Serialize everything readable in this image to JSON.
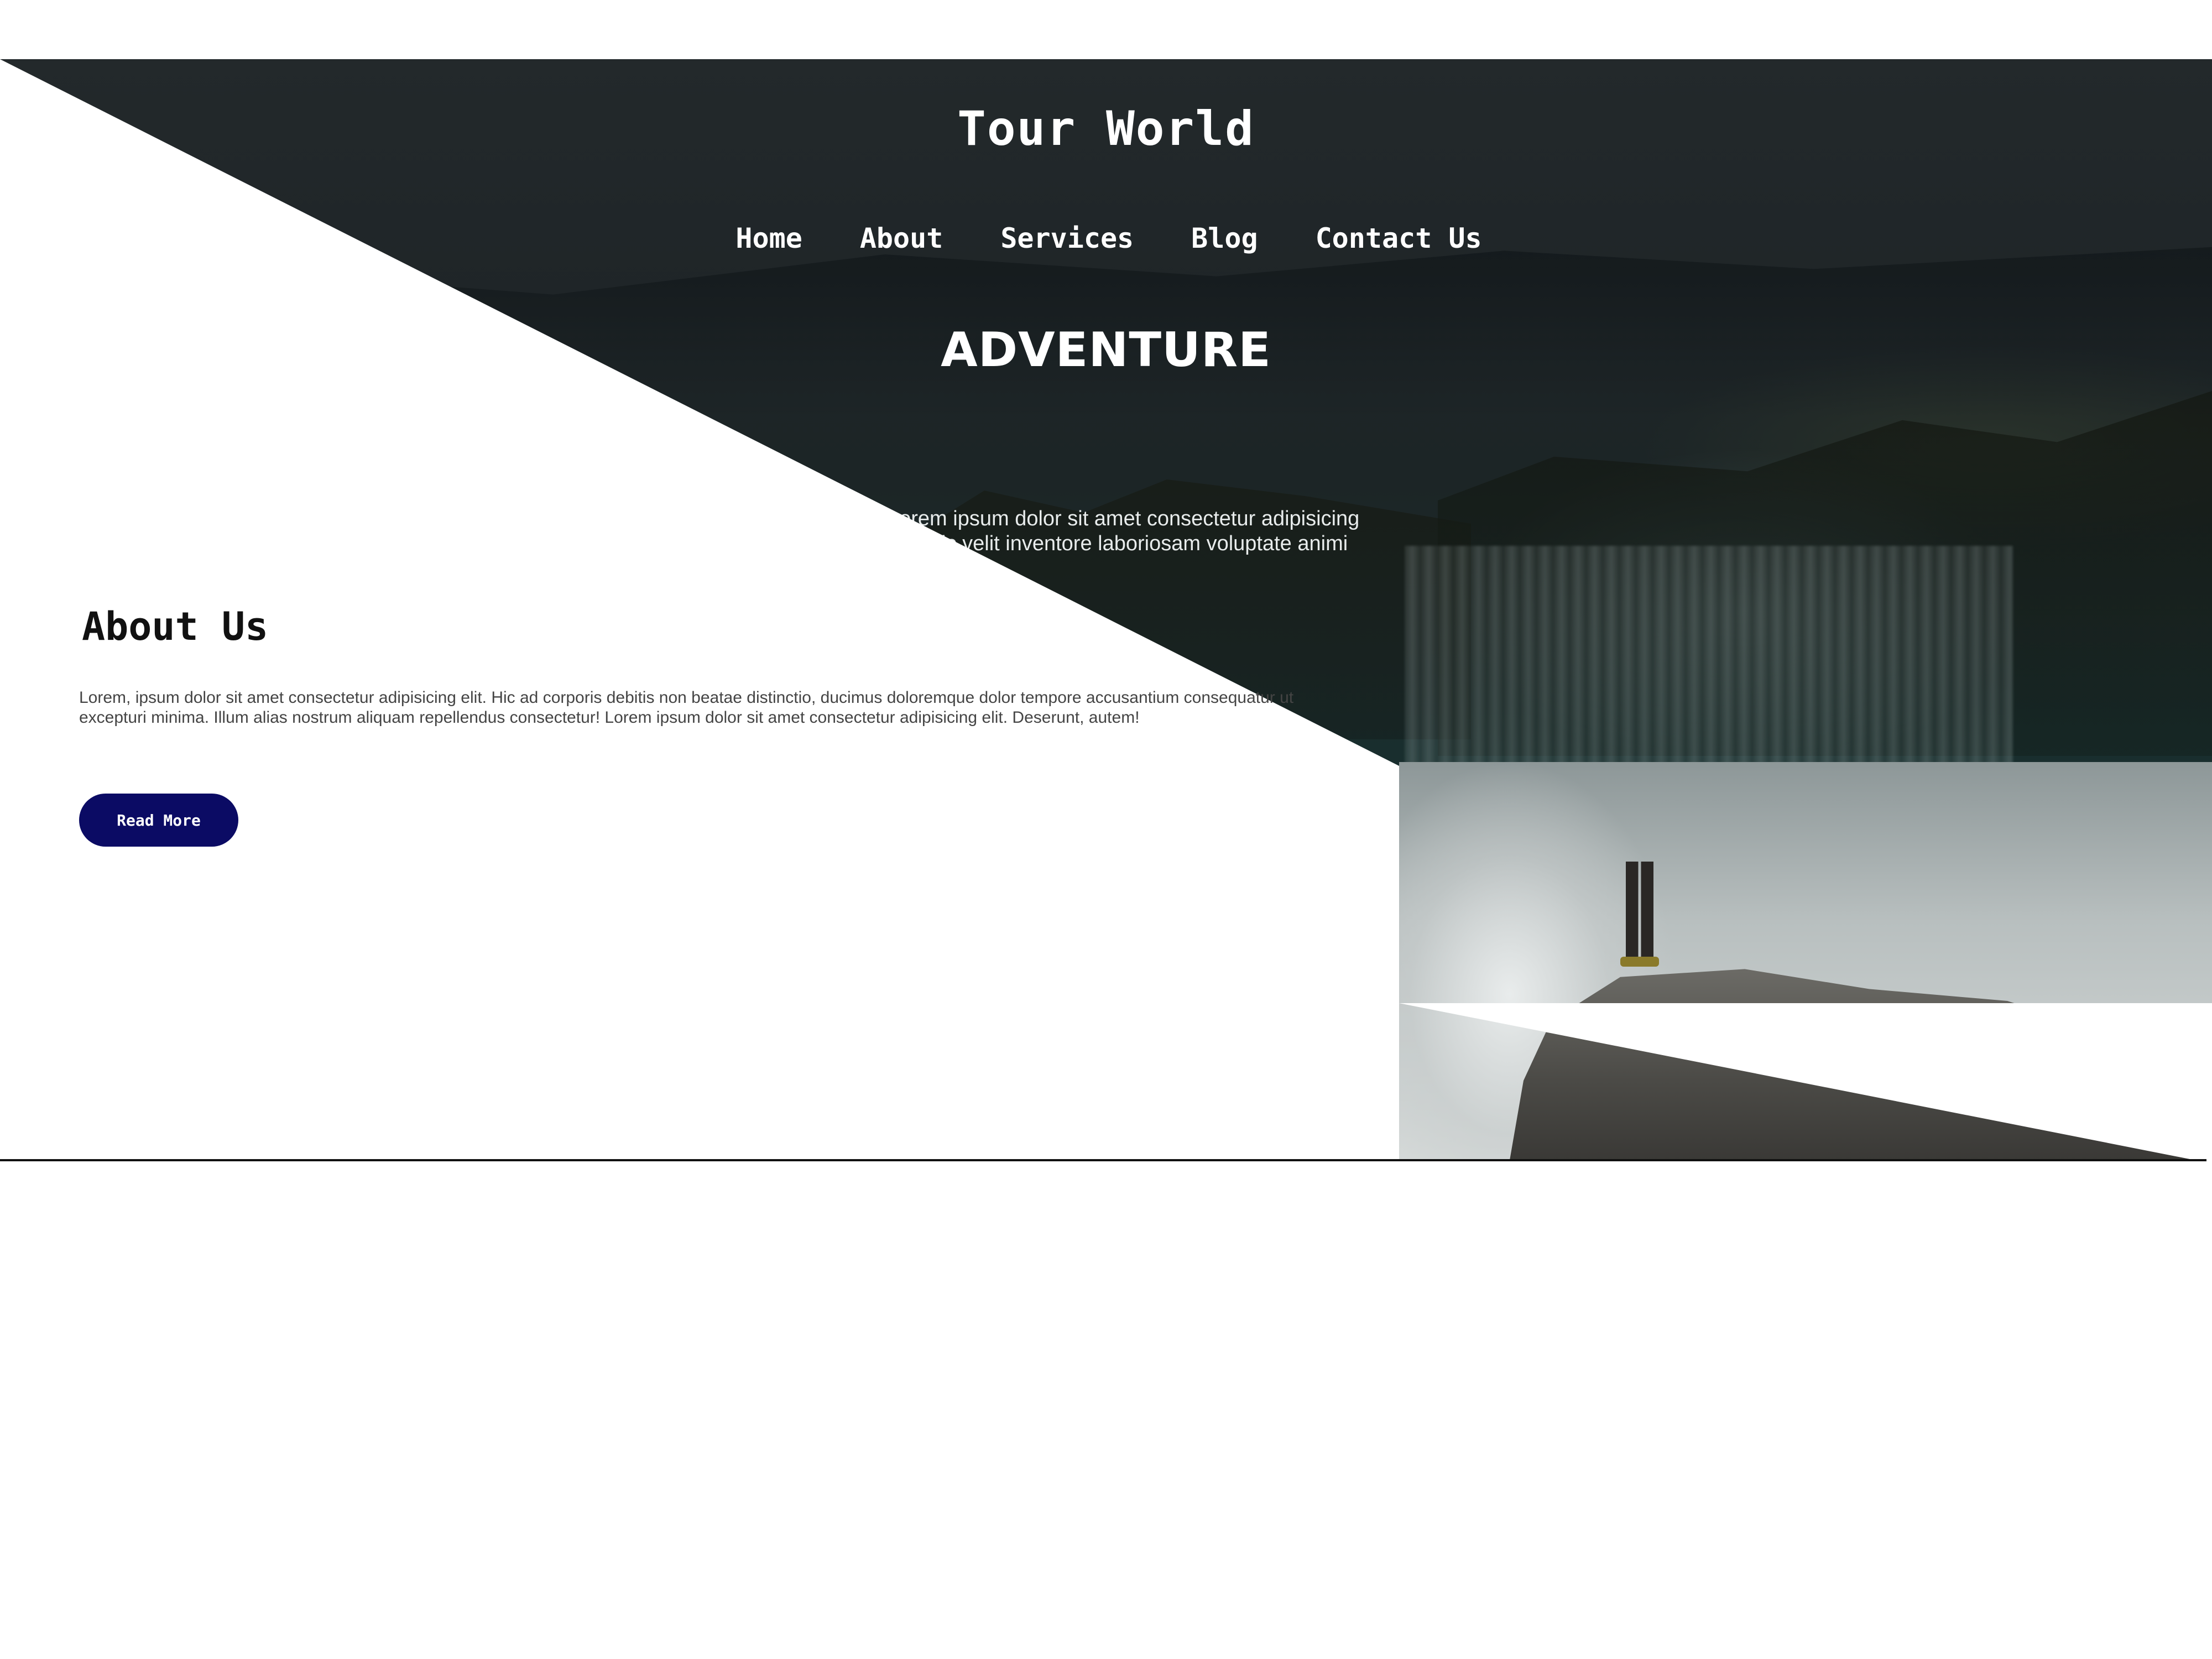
{
  "header": {
    "site_title": "Tour World",
    "nav": {
      "home": "Home",
      "about": "About",
      "services": "Services",
      "blog": "Blog",
      "contact": "Contact Us"
    }
  },
  "hero": {
    "heading": "ADVENTURE",
    "text": "Lorem ipsum dolor sit amet consectetur adipisicing elit. Hic velit inventore laboriosam voluptate animi ad quae"
  },
  "about": {
    "title": "About Us",
    "text": "Lorem, ipsum dolor sit amet consectetur adipisicing elit. Hic ad corporis debitis non beatae distinctio, ducimus doloremque dolor tempore accusantium consequatur ut excepturi minima. Illum alias nostrum aliquam repellendus consectetur! Lorem ipsum dolor sit amet consectetur adipisicing elit. Deserunt, autem!",
    "button_label": "Read More"
  },
  "colors": {
    "button_bg": "#0b0b64",
    "hero_dark": "#1f2528",
    "text_light": "#ffffff"
  }
}
